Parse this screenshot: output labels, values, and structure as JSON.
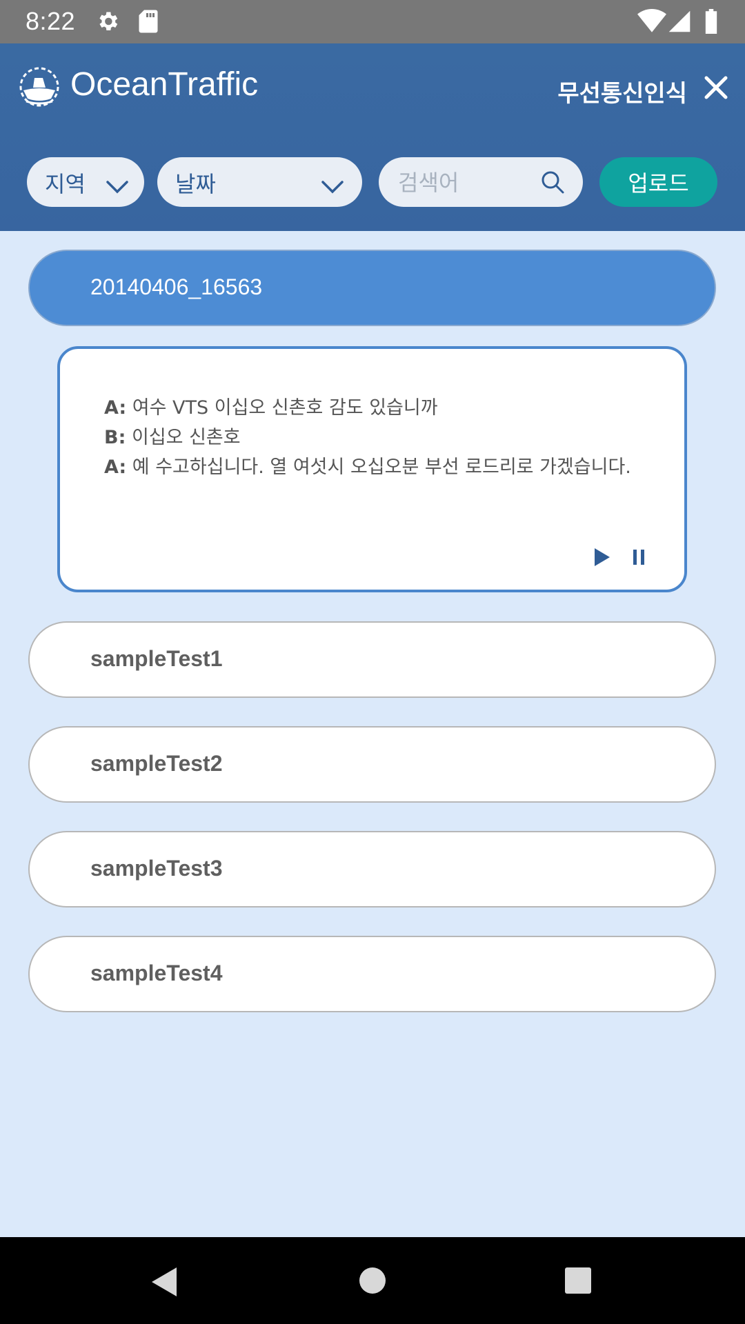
{
  "status": {
    "time": "8:22"
  },
  "header": {
    "app_title": "OceanTraffic",
    "mode_label": "무선통신인식"
  },
  "filters": {
    "region_label": "지역",
    "date_label": "날짜",
    "search_placeholder": "검색어",
    "upload_label": "업로드"
  },
  "recordings": {
    "active": {
      "name": "20140406_16563",
      "transcript": [
        {
          "speaker": "A:",
          "text": "여수 VTS 이십오 신촌호 감도 있습니까"
        },
        {
          "speaker": "B:",
          "text": "이십오 신촌호"
        },
        {
          "speaker": "A:",
          "text": "예 수고하십니다. 열 여섯시 오십오분 부선 로드리로 가겠습니다."
        }
      ]
    },
    "items": [
      {
        "name": "sampleTest1"
      },
      {
        "name": "sampleTest2"
      },
      {
        "name": "sampleTest3"
      },
      {
        "name": "sampleTest4"
      }
    ]
  },
  "colors": {
    "header_bg": "#3a6aa2",
    "accent_teal": "#0fa39f",
    "active_item": "#4d8cd4",
    "page_bg": "#dbe9fa"
  },
  "icons": {
    "status": [
      "gear-icon",
      "sd-card-icon",
      "wifi-icon",
      "signal-icon",
      "battery-icon"
    ],
    "header": [
      "ship-logo-icon",
      "close-icon"
    ],
    "filters": [
      "chevron-down-icon",
      "search-icon"
    ],
    "player": [
      "play-icon",
      "pause-icon"
    ],
    "nav": [
      "back-icon",
      "home-icon",
      "recents-icon"
    ]
  }
}
